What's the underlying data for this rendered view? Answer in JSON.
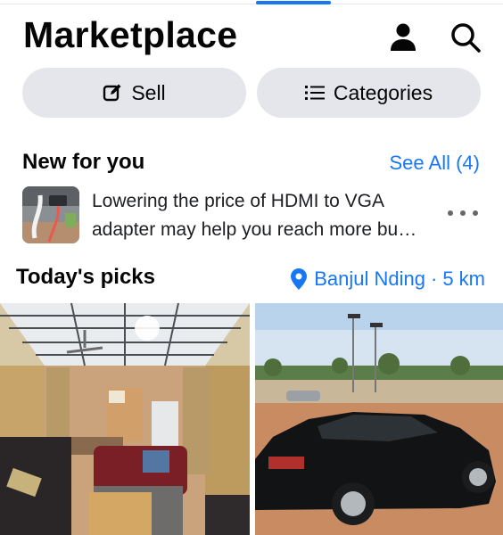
{
  "header": {
    "title": "Marketplace"
  },
  "actions": {
    "sell_label": "Sell",
    "categories_label": "Categories"
  },
  "new_for_you": {
    "title": "New for you",
    "see_all": "See All (4)",
    "notification": {
      "line1": "Lowering the price of HDMI to VGA",
      "line2": "adapter may help you reach more bu…"
    }
  },
  "todays_picks": {
    "title": "Today's picks",
    "location": "Banjul Nding",
    "separator": "·",
    "distance": "5 km"
  },
  "colors": {
    "accent": "#1877f2",
    "pill_bg": "#e4e6eb",
    "text": "#050505"
  },
  "icons": [
    "profile-icon",
    "search-icon",
    "edit-icon",
    "list-icon",
    "more-icon",
    "location-pin-icon"
  ]
}
